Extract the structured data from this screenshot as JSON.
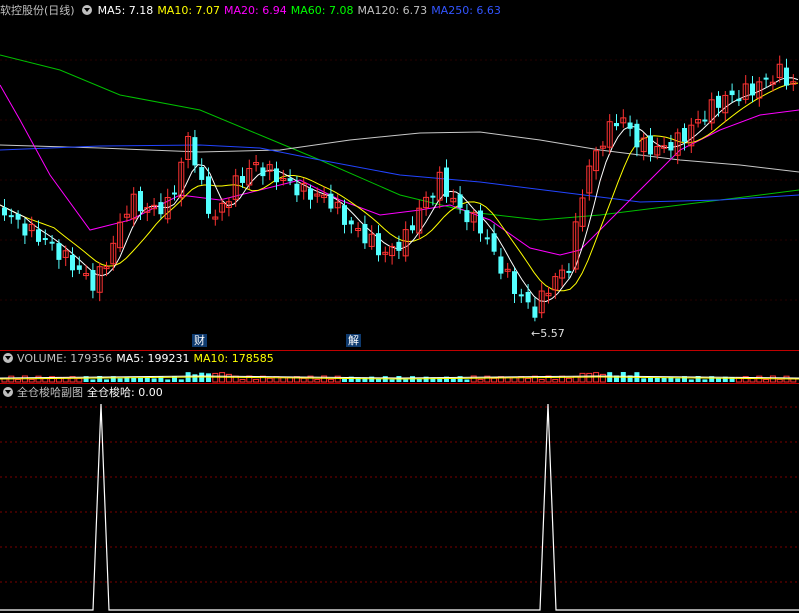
{
  "main": {
    "title": "软控股份(日线)",
    "indicators": [
      {
        "label": "MA5: 7.18",
        "color": "#ffffff"
      },
      {
        "label": "MA10: 7.07",
        "color": "#ffff00"
      },
      {
        "label": "MA20: 6.94",
        "color": "#ff00ff"
      },
      {
        "label": "MA60: 7.08",
        "color": "#00ff00"
      },
      {
        "label": "MA120: 6.73",
        "color": "#c0c0c0"
      },
      {
        "label": "MA250: 6.63",
        "color": "#3355ff"
      }
    ],
    "markers": {
      "cai": "财",
      "jie": "解"
    },
    "low_label": "←5.57"
  },
  "volume": {
    "indicators": [
      {
        "label": "VOLUME: 179356",
        "color": "#c0c0c0"
      },
      {
        "label": "MA5: 199231",
        "color": "#ffffff"
      },
      {
        "label": "MA10: 178585",
        "color": "#ffff00"
      }
    ]
  },
  "sub": {
    "title": "全仓梭哈副图",
    "indicators": [
      {
        "label": "全仓梭哈: 0.00",
        "color": "#ffffff"
      }
    ]
  },
  "colors": {
    "up": "#ff3333",
    "down": "#54ffff",
    "grid": "#7a0000"
  }
}
